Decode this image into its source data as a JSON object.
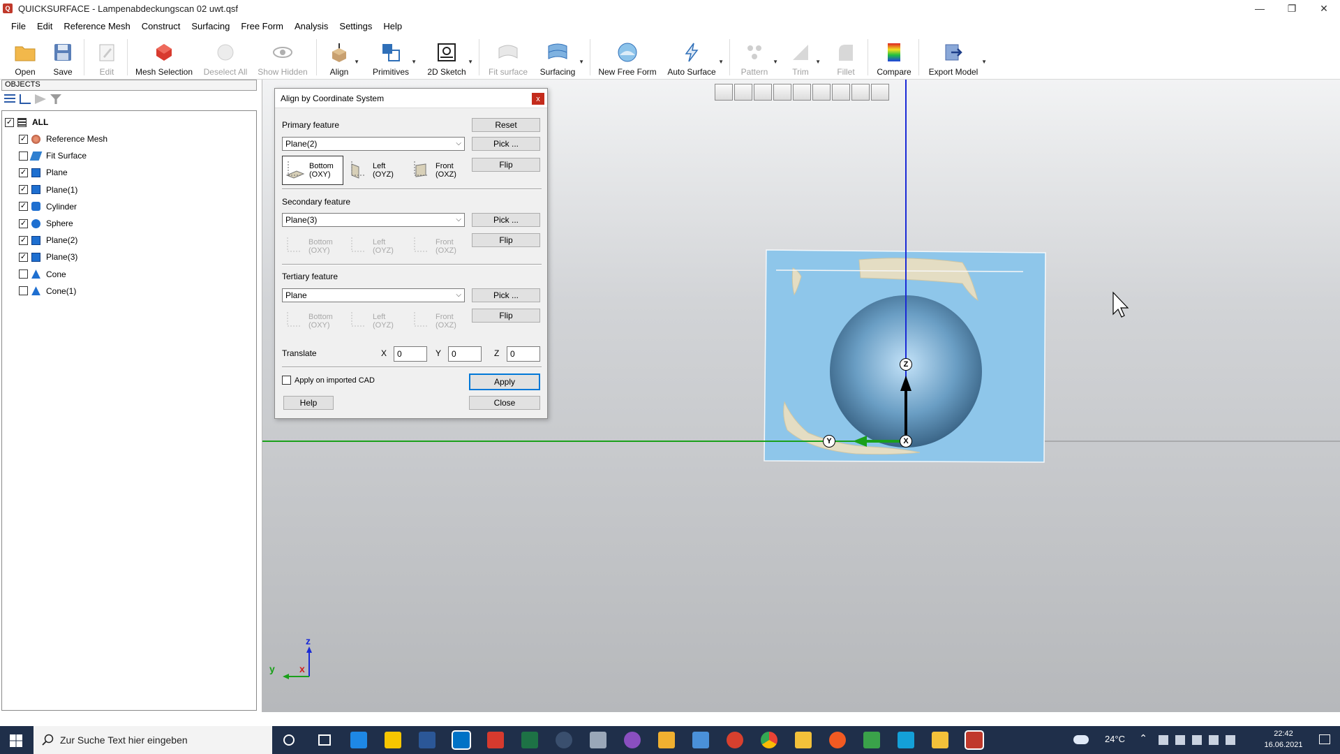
{
  "window": {
    "title": "QUICKSURFACE - Lampenabdeckungscan 02 uwt.qsf",
    "controls": [
      "—",
      "❐",
      "✕"
    ]
  },
  "menu": [
    "File",
    "Edit",
    "Reference Mesh",
    "Construct",
    "Surfacing",
    "Free Form",
    "Analysis",
    "Settings",
    "Help"
  ],
  "toolbar": {
    "open": "Open",
    "save": "Save",
    "edit": "Edit",
    "mesh_selection": "Mesh Selection",
    "deselect_all": "Deselect All",
    "show_hidden": "Show Hidden",
    "align": "Align",
    "primitives": "Primitives",
    "sketch2d": "2D Sketch",
    "fit_surface": "Fit surface",
    "surfacing": "Surfacing",
    "new_free_form": "New Free Form",
    "auto_surface": "Auto Surface",
    "pattern": "Pattern",
    "trim": "Trim",
    "fillet": "Fillet",
    "compare": "Compare",
    "export_model": "Export Model"
  },
  "objects": {
    "header": "OBJECTS",
    "root": "ALL",
    "items": [
      {
        "label": "Reference Mesh",
        "checked": true,
        "icon": "mesh-icon"
      },
      {
        "label": "Fit Surface",
        "checked": false,
        "icon": "surface-icon"
      },
      {
        "label": "Plane",
        "checked": true,
        "icon": "plane-icon"
      },
      {
        "label": "Plane(1)",
        "checked": true,
        "icon": "plane-icon"
      },
      {
        "label": "Cylinder",
        "checked": true,
        "icon": "cylinder-icon"
      },
      {
        "label": "Sphere",
        "checked": true,
        "icon": "sphere-icon"
      },
      {
        "label": "Plane(2)",
        "checked": true,
        "icon": "plane-icon"
      },
      {
        "label": "Plane(3)",
        "checked": true,
        "icon": "plane-icon"
      },
      {
        "label": "Cone",
        "checked": false,
        "icon": "cone-icon"
      },
      {
        "label": "Cone(1)",
        "checked": false,
        "icon": "cone-icon"
      }
    ]
  },
  "dialog": {
    "title": "Align by Coordinate System",
    "close_x": "x",
    "primary_label": "Primary feature",
    "primary_value": "Plane(2)",
    "secondary_label": "Secondary feature",
    "secondary_value": "Plane(3)",
    "tertiary_label": "Tertiary feature",
    "tertiary_value": "Plane",
    "reset": "Reset",
    "pick": "Pick ...",
    "flip": "Flip",
    "bottom1": "Bottom",
    "bottom2": "(OXY)",
    "left1": "Left",
    "left2": "(OYZ)",
    "front1": "Front",
    "front2": "(OXZ)",
    "translate": "Translate",
    "x_label": "X",
    "y_label": "Y",
    "z_label": "Z",
    "x_val": "0",
    "y_val": "0",
    "z_val": "0",
    "apply_cad": "Apply on imported CAD",
    "apply": "Apply",
    "help": "Help",
    "close": "Close"
  },
  "viewport": {
    "axis_z": "Z",
    "axis_y": "Y",
    "axis_x": "X",
    "triad_z": "z",
    "triad_y": "y",
    "triad_x": "x"
  },
  "taskbar": {
    "search_placeholder": "Zur Suche Text hier eingeben",
    "temperature": "24°C",
    "time": "22:42",
    "date": "16.06.2021"
  },
  "colors": {
    "accent": "#0078d7",
    "plane_fill": "#8ec6ea",
    "sphere": "#6a9ec4",
    "mesh": "#e4ddc3",
    "axis_z": "#1a2ad6",
    "axis_y": "#1aa01a",
    "taskbar": "#1f2f4a"
  }
}
